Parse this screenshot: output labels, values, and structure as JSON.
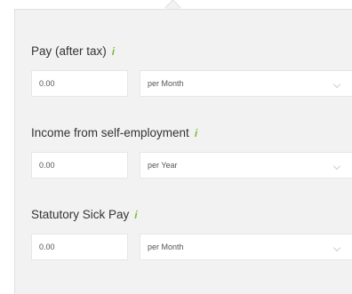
{
  "fields": [
    {
      "label": "Pay (after tax)",
      "info": "i",
      "amount": "0.00",
      "period": "per Month"
    },
    {
      "label": "Income from self-employment",
      "info": "i",
      "amount": "0.00",
      "period": "per Year"
    },
    {
      "label": "Statutory Sick Pay",
      "info": "i",
      "amount": "0.00",
      "period": "per Month"
    }
  ],
  "colors": {
    "panel_bg": "#f2f2f2",
    "info_icon": "#7bbf3a"
  }
}
